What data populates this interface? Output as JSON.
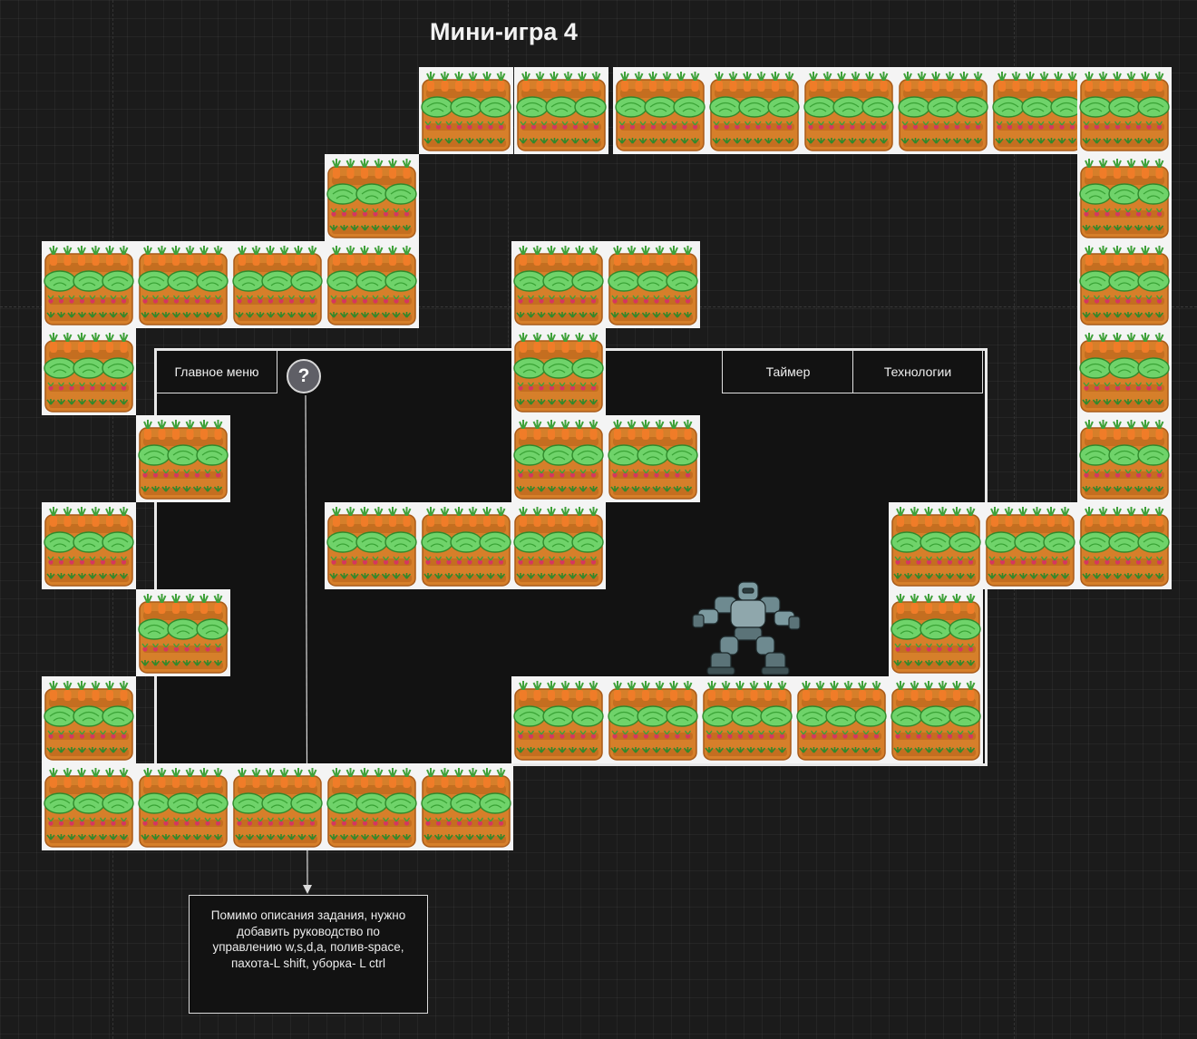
{
  "page_title": "Мини-игра 4",
  "toolbar": {
    "main_menu": "Главное меню",
    "help_icon": "question-icon",
    "help_symbol": "?",
    "timer": "Таймер",
    "technologies": "Технологии"
  },
  "note": {
    "text": "Помимо описания задания, нужно добавить руководство по управлению w,s,d,a, полив-space, пахота-L shift, уборка- L ctrl"
  },
  "tile_icon": "vegetable-garden-bed-icon",
  "player_icon": "robot-icon",
  "colors": {
    "background": "#1b1b1b",
    "soil": "#d67f2a",
    "cabbage": "#6fd36a",
    "carrot": "#f07c28",
    "frame_border": "#e9e9e9"
  }
}
